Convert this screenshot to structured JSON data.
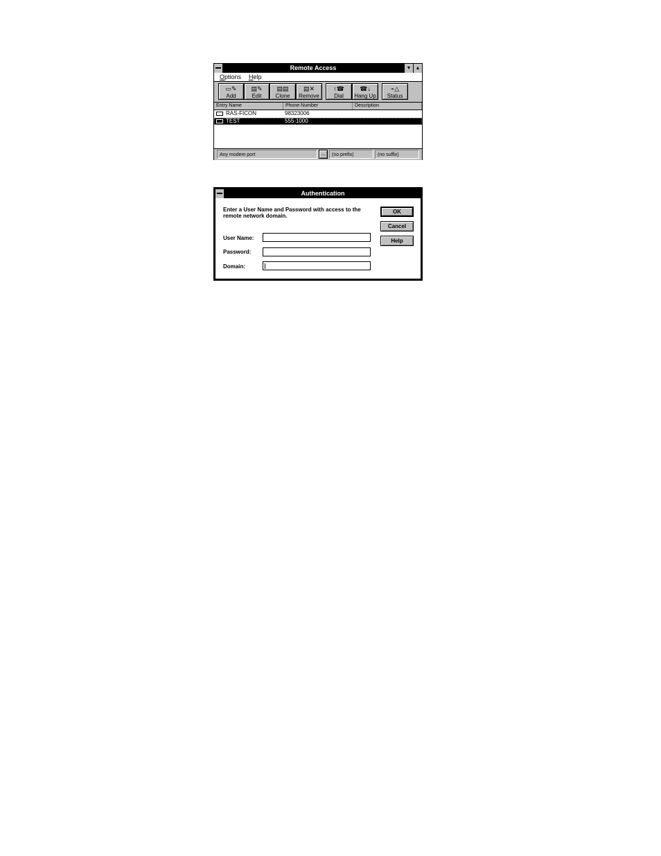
{
  "remote_access": {
    "title": "Remote Access",
    "menu": [
      {
        "label": "Options",
        "accel": "O"
      },
      {
        "label": "Help",
        "accel": "H"
      }
    ],
    "toolbar": [
      {
        "label": "Add",
        "icon": "add-icon"
      },
      {
        "label": "Edit",
        "icon": "edit-icon"
      },
      {
        "label": "Clone",
        "icon": "clone-icon"
      },
      {
        "label": "Remove",
        "icon": "remove-icon"
      },
      {
        "label": "Dial",
        "icon": "dial-icon"
      },
      {
        "label": "Hang Up",
        "icon": "hang-up-icon"
      },
      {
        "label": "Status",
        "icon": "status-icon"
      }
    ],
    "columns": [
      "Entry Name",
      "Phone Number",
      "Description"
    ],
    "rows": [
      {
        "entry": "RAS-FICON",
        "phone": "98323006",
        "description": "",
        "selected": false
      },
      {
        "entry": "TEST",
        "phone": "555-1000",
        "description": "",
        "selected": true
      }
    ],
    "status": {
      "port": "Any modem port",
      "browse": "...",
      "prefix": "(no prefix)",
      "suffix": "(no suffix)"
    }
  },
  "authentication": {
    "title": "Authentication",
    "prompt": "Enter a User Name and Password with access to the remote network domain.",
    "fields": [
      {
        "label": "User Name:",
        "value": ""
      },
      {
        "label": "Password:",
        "value": ""
      },
      {
        "label": "Domain:",
        "value": ""
      }
    ],
    "buttons": [
      "OK",
      "Cancel",
      "Help"
    ]
  }
}
